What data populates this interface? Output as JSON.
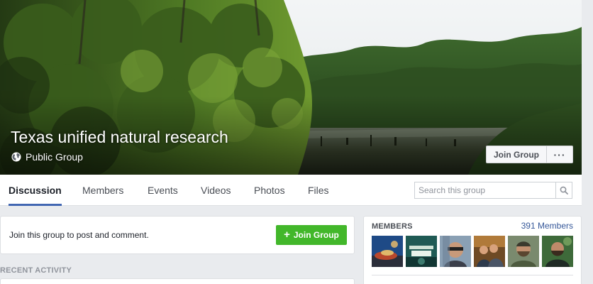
{
  "group": {
    "name": "Texas unified natural research",
    "privacy_label": "Public Group",
    "privacy_icon": "globe-icon",
    "join_button_label": "Join Group",
    "more_icon": "ellipsis-icon",
    "more_label": "···"
  },
  "tabs": [
    {
      "label": "Discussion",
      "active": true
    },
    {
      "label": "Members",
      "active": false
    },
    {
      "label": "Events",
      "active": false
    },
    {
      "label": "Videos",
      "active": false
    },
    {
      "label": "Photos",
      "active": false
    },
    {
      "label": "Files",
      "active": false
    }
  ],
  "search": {
    "placeholder": "Search this group",
    "icon": "magnifier-icon"
  },
  "join_card": {
    "prompt": "Join this group to post and comment.",
    "button_label": "Join Group",
    "button_icon": "plus-icon",
    "button_plus": "+"
  },
  "recent_activity": {
    "heading": "RECENT ACTIVITY"
  },
  "members": {
    "heading": "MEMBERS",
    "count_label": "391 Members",
    "thumbnails": [
      "member-avatar",
      "member-avatar",
      "member-avatar",
      "member-avatar",
      "member-avatar",
      "member-avatar"
    ]
  },
  "colors": {
    "accent_blue": "#4267b2",
    "link_blue": "#365899",
    "join_green": "#42b72a",
    "page_background": "#e9ebee"
  }
}
